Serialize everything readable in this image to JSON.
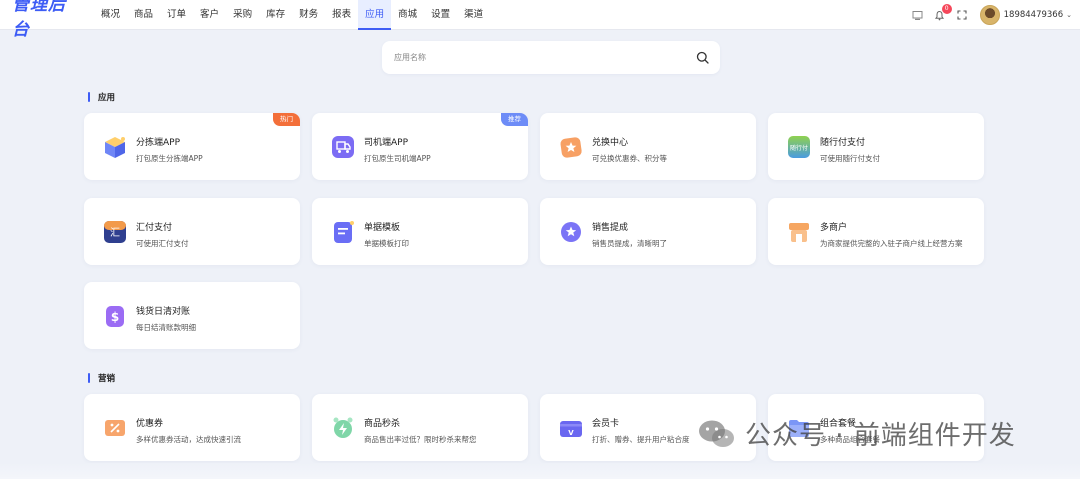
{
  "header": {
    "logo": "管理后台",
    "nav": [
      "概况",
      "商品",
      "订单",
      "客户",
      "采购",
      "库存",
      "财务",
      "报表",
      "应用",
      "商城",
      "设置",
      "渠道"
    ],
    "active_nav": "应用",
    "notification_count": "0",
    "username": "18984479366"
  },
  "search": {
    "placeholder": "应用名称",
    "value": ""
  },
  "sections": [
    {
      "title": "应用",
      "cards": [
        {
          "name": "分拣端APP",
          "desc": "打包原生分拣端APP",
          "tag": "热门",
          "tag_color": "#f36f3a",
          "icon": "box-icon"
        },
        {
          "name": "司机端APP",
          "desc": "打包原生司机端APP",
          "tag": "推荐",
          "tag_color": "#6d8cf7",
          "icon": "truck-icon"
        },
        {
          "name": "兑换中心",
          "desc": "可兑换优惠券、积分等",
          "icon": "star-folder-icon"
        },
        {
          "name": "随行付支付",
          "desc": "可使用随行付支付",
          "icon": "suixingfu-icon"
        },
        {
          "name": "汇付支付",
          "desc": "可使用汇付支付",
          "icon": "huifu-icon"
        },
        {
          "name": "单据模板",
          "desc": "单据模板打印",
          "icon": "document-icon"
        },
        {
          "name": "销售提成",
          "desc": "销售员提成，清晰明了",
          "icon": "medal-icon"
        },
        {
          "name": "多商户",
          "desc": "为商家提供完整的入驻子商户线上经营方案",
          "icon": "store-icon"
        },
        {
          "name": "钱货日清对账",
          "desc": "每日结清账款明细",
          "icon": "dollar-icon"
        }
      ]
    },
    {
      "title": "营销",
      "cards": [
        {
          "name": "优惠券",
          "desc": "多样优惠券活动，达成快速引流",
          "icon": "coupon-icon"
        },
        {
          "name": "商品秒杀",
          "desc": "商品售出率过低？限时秒杀来帮您",
          "icon": "alarm-icon"
        },
        {
          "name": "会员卡",
          "desc": "打折、赠券、提升用户粘合度",
          "icon": "member-card-icon"
        },
        {
          "name": "组合套餐",
          "desc": "多种商品组合套餐",
          "icon": "folder-icon"
        }
      ]
    }
  ],
  "watermark": "公众号 · 前端组件开发",
  "colors": {
    "accent": "#3d5cf5",
    "hot_tag": "#f36f3a",
    "recommend_tag": "#6d8cf7"
  }
}
